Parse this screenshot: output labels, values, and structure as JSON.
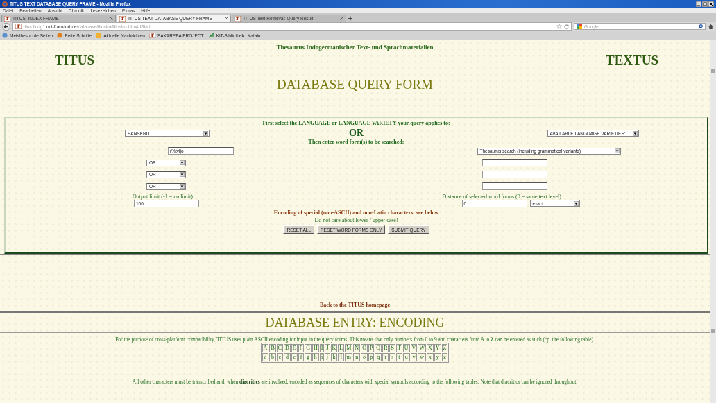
{
  "window": {
    "title": "TITUS TEXT DATABASE QUERY FRAME - Mozilla Firefox"
  },
  "menu": [
    "Datei",
    "Bearbeiten",
    "Ansicht",
    "Chronik",
    "Lesezeichen",
    "Extras",
    "Hilfe"
  ],
  "tabs": [
    {
      "label": "TITUS: INDEX FRAME",
      "selected": false
    },
    {
      "label": "TITUS TEXT DATABASE QUERY FRAME",
      "selected": true
    },
    {
      "label": "TITUS Text Retrieval: Query Result",
      "selected": false
    }
  ],
  "address": {
    "host_prefix": "titus.fkidg1.",
    "domain": "uni-frankfurt.de",
    "path": "/database/titusinx/titusinx.htm#dStart"
  },
  "search": {
    "placeholder": "Google"
  },
  "bookmarks": [
    "Meistbesuchte Seiten",
    "Erste Schritte",
    "Aktuelle Nachrichten",
    "SAXAREBA PROJECT",
    "KIT-Bibliothek | Katalo..."
  ],
  "header": {
    "subtitle": "Thesaurus Indogermanischer Text- und Sprachmaterialien",
    "left_logo": "TITUS",
    "right_logo": "TEXTUS",
    "title": "DATABASE QUERY FORM"
  },
  "form": {
    "instruction": "First select the LANGUAGE or LANGUAGE VARIETY your query applies to:",
    "language": "SANSKRIT",
    "or_label": "OR",
    "variety": "AVAILABLE LANGUAGE VARIETIES:",
    "word_prompt": "Then enter word form(s) to be searched:",
    "first_word": "r%tvijo",
    "search_mode": "Thesaurus search (including grammatical variants)",
    "operators": [
      "OR",
      "OR",
      "OR"
    ],
    "output_limit_label": "Output limit (-1 = no limit)",
    "output_limit": "100",
    "distance_label": "Distance of selected word forms (0 = same text level)",
    "distance": "0",
    "distance_mode": "exact",
    "encoding_note": "Encoding of special (non-ASCII) and non-Latin characters: see below",
    "case_note": "Do not care about lower / upper case!",
    "buttons": [
      "RESET ALL",
      "RESET WORD FORMS ONLY",
      "SUBMIT QUERY"
    ]
  },
  "footer": {
    "link": "Back to the TITUS homepage"
  },
  "encoding": {
    "title": "DATABASE ENTRY: ENCODING",
    "intro": "For the purpose of cross-platform compatibility, TITUS uses plain ASCII encoding for input in the query forms. This means that only numbers from 0 to 9 and characters from A to Z can be entered as such (cp. the following table).",
    "upper": [
      "A",
      "B",
      "C",
      "D",
      "E",
      "F",
      "G",
      "H",
      "I",
      "J",
      "K",
      "L",
      "M",
      "N",
      "O",
      "P",
      "Q",
      "R",
      "S",
      "T",
      "U",
      "V",
      "W",
      "X",
      "Y",
      "Z"
    ],
    "lower": [
      "a",
      "b",
      "c",
      "d",
      "e",
      "f",
      "g",
      "h",
      "i",
      "j",
      "k",
      "l",
      "m",
      "n",
      "o",
      "p",
      "q",
      "r",
      "s",
      "t",
      "u",
      "v",
      "w",
      "x",
      "y",
      "z"
    ],
    "note": "All other characters must be transcribed and, when **diacritics** are involved, encoded as sequences of characters with special symbols according to the following tables. Note that diacritics can be ignored throughout."
  }
}
